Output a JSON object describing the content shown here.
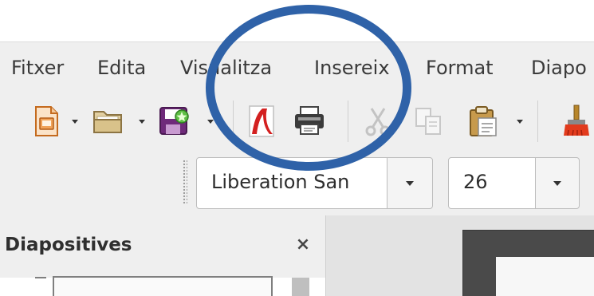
{
  "menubar": {
    "items": [
      "Fitxer",
      "Edita",
      "Visualitza",
      "Insereix",
      "Format",
      "Diapo"
    ]
  },
  "toolbar": {
    "icons": [
      "new-document-icon",
      "open-folder-icon",
      "save-icon",
      "export-pdf-icon",
      "print-icon",
      "cut-icon",
      "copy-icon",
      "paste-icon",
      "clone-formatting-icon"
    ]
  },
  "format_toolbar": {
    "font_name": "Liberation San",
    "font_size": "26"
  },
  "slides_panel": {
    "title": "Diapositives",
    "close_label": "×"
  },
  "colors": {
    "annotation": "#2f62a8",
    "toolbar_bg": "#efefef"
  }
}
